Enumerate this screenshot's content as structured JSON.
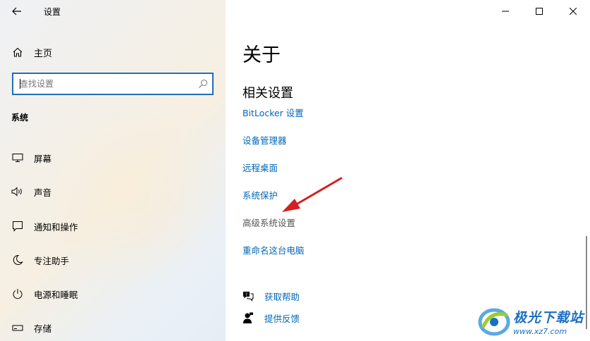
{
  "window": {
    "title": "设置",
    "controls": {
      "minimize": "minimize",
      "maximize": "maximize",
      "close": "close"
    }
  },
  "sidebar": {
    "home_label": "主页",
    "search_placeholder": "查找设置",
    "section_title": "系统",
    "items": [
      {
        "label": "屏幕",
        "icon": "monitor-icon"
      },
      {
        "label": "声音",
        "icon": "speaker-icon"
      },
      {
        "label": "通知和操作",
        "icon": "notification-icon"
      },
      {
        "label": "专注助手",
        "icon": "moon-icon"
      },
      {
        "label": "电源和睡眠",
        "icon": "power-icon"
      },
      {
        "label": "存储",
        "icon": "storage-icon"
      }
    ]
  },
  "main": {
    "page_title": "关于",
    "related_heading": "相关设置",
    "related_links": [
      "BitLocker 设置",
      "设备管理器",
      "远程桌面",
      "系统保护",
      "高级系统设置",
      "重命名这台电脑"
    ],
    "help": {
      "get_help": "获取帮助",
      "feedback": "提供反馈"
    }
  },
  "watermark": {
    "name": "极光下载站",
    "url": "www.xz7.com"
  },
  "colors": {
    "link": "#0067b8",
    "accent_border": "#1f6fb5",
    "annotation_arrow": "#d42020"
  }
}
